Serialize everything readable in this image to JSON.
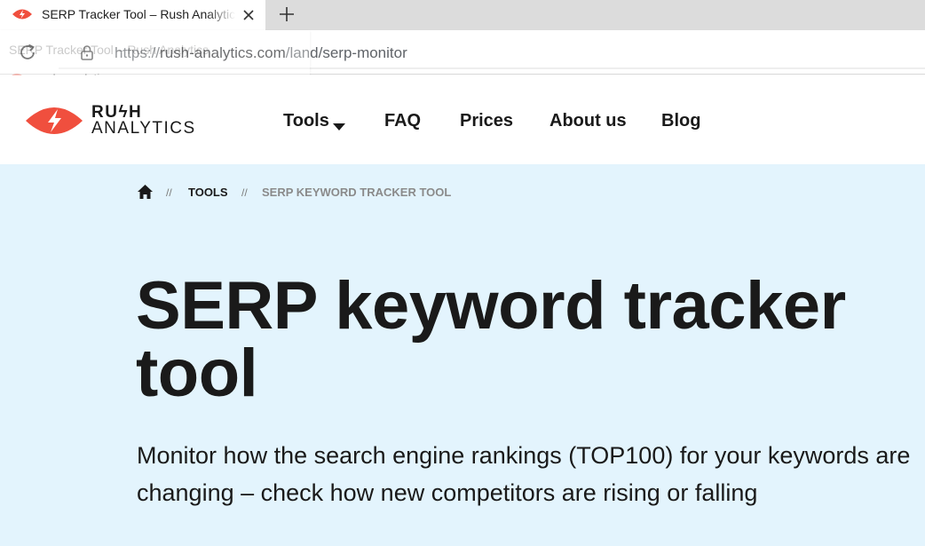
{
  "browser": {
    "tab": {
      "title": "SERP Tracker Tool – Rush Analytics",
      "favicon": "rush-eye-icon",
      "close_icon": "close-icon"
    },
    "new_tab_icon": "plus-icon",
    "reload_icon": "reload-icon",
    "lock_icon": "lock-icon",
    "url": {
      "scheme": "https://",
      "host": "rush-analytics.com",
      "path": "/land/serp-monitor"
    },
    "hover_card": {
      "title": "SERP Tracker Tool – Rush Analytics",
      "domain": "rush-analytics.com"
    }
  },
  "site": {
    "logo": {
      "line1": "RUϟH",
      "line2": "ANALYTICS",
      "mark_color": "#f04f3e"
    },
    "nav": {
      "tools": "Tools",
      "faq": "FAQ",
      "prices": "Prices",
      "about": "About us",
      "blog": "Blog"
    }
  },
  "hero": {
    "background": "#e3f4fd",
    "breadcrumb": {
      "home_icon": "home-icon",
      "separator": "//",
      "tools": "TOOLS",
      "current": "SERP KEYWORD TRACKER TOOL"
    },
    "title": "SERP keyword tracker tool",
    "description": "Monitor how the search engine rankings (TOP100) for your keywords are changing – check how new competitors are rising or falling"
  }
}
